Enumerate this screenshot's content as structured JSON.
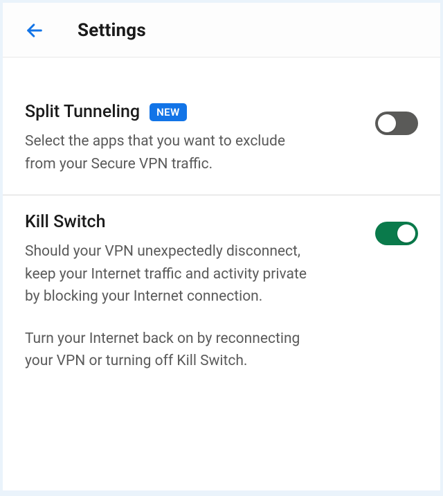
{
  "header": {
    "title": "Settings"
  },
  "settings": {
    "split_tunneling": {
      "title": "Split Tunneling",
      "badge": "NEW",
      "description": "Select the apps that you want to exclude from your Secure VPN traffic.",
      "enabled": false
    },
    "kill_switch": {
      "title": "Kill Switch",
      "description_p1": "Should your VPN unexpectedly disconnect, keep your Internet traffic and activity private by blocking your Internet connection.",
      "description_p2": "Turn your Internet back on by reconnecting your VPN or turning off Kill Switch.",
      "enabled": true
    }
  },
  "colors": {
    "accent_blue": "#1274e7",
    "toggle_on": "#0a7a4b",
    "toggle_off": "#5a5a58"
  }
}
